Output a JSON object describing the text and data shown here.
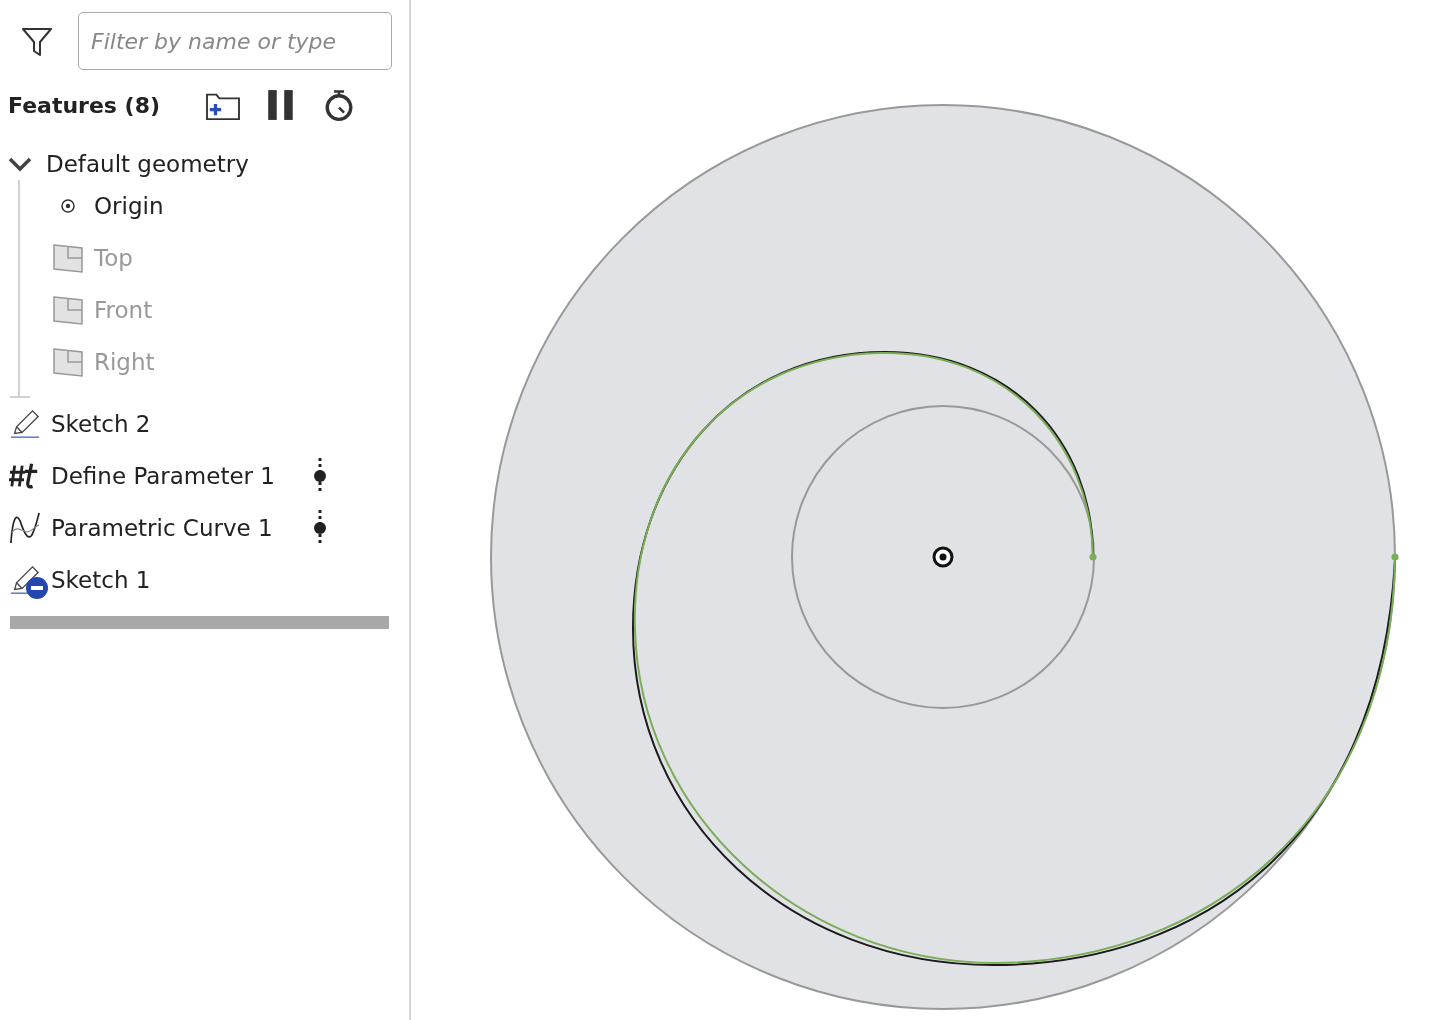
{
  "filter": {
    "placeholder": "Filter by name or type"
  },
  "features_header": {
    "title": "Features (8)"
  },
  "tree": [
    {
      "label": "Default geometry",
      "kind": "group",
      "expanded": true,
      "children": [
        {
          "label": "Origin",
          "kind": "point",
          "hidden": false
        },
        {
          "label": "Top",
          "kind": "plane",
          "hidden": true
        },
        {
          "label": "Front",
          "kind": "plane",
          "hidden": true
        },
        {
          "label": "Right",
          "kind": "plane",
          "hidden": true
        }
      ]
    },
    {
      "label": "Sketch 2",
      "kind": "sketch",
      "excluded": false,
      "dependency": false
    },
    {
      "label": "Define Parameter 1",
      "kind": "parameter",
      "excluded": false,
      "dependency": true
    },
    {
      "label": "Parametric Curve 1",
      "kind": "curve",
      "excluded": false,
      "dependency": true
    },
    {
      "label": "Sketch 1",
      "kind": "sketch",
      "excluded": true,
      "dependency": false
    }
  ]
}
